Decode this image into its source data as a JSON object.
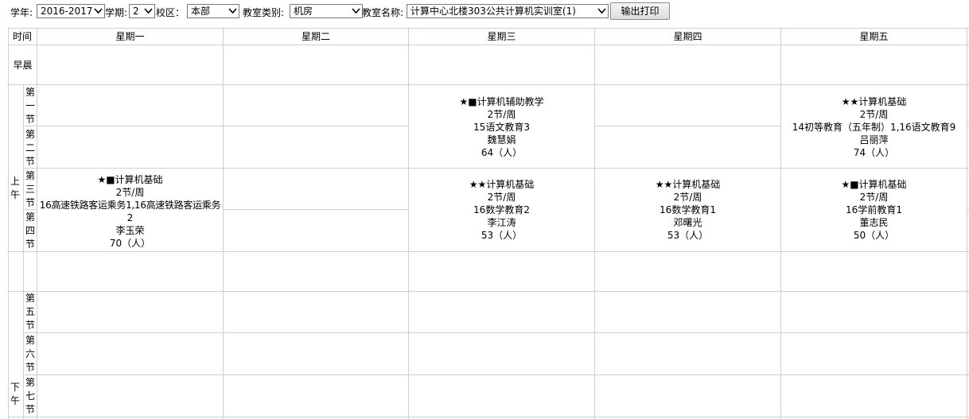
{
  "toolbar": {
    "year_label": "学年:",
    "year_value": "2016-2017",
    "term_label": "学期:",
    "term_value": "2",
    "campus_label": "校区：",
    "campus_value": "本部",
    "room_type_label": "教室类别:",
    "room_type_value": "机房",
    "room_name_label": "教室名称:",
    "room_name_value": "计算中心北楼303公共计算机实训室(1)",
    "print_button": "输出打印"
  },
  "table": {
    "time_header": "时间",
    "days": [
      "星期一",
      "星期二",
      "星期三",
      "星期四",
      "星期五"
    ],
    "early": "早晨",
    "morning": "上午",
    "afternoon": "下午",
    "periods": [
      "第一节",
      "第二节",
      "第三节",
      "第四节",
      "第五节",
      "第六节",
      "第七节"
    ]
  },
  "courses": {
    "wed_12": {
      "title": "★■计算机辅助教学",
      "hours": "2节/周",
      "class": "15语文教育3",
      "teacher": "魏慧娟",
      "count": "64（人）"
    },
    "fri_12": {
      "title": "★★计算机基础",
      "hours": "2节/周",
      "class": "14初等教育（五年制）1,16语文教育9",
      "teacher": "吕丽萍",
      "count": "74（人）"
    },
    "mon_34": {
      "title": "★■计算机基础",
      "hours": "2节/周",
      "class": "16高速铁路客运乘务1,16高速铁路客运乘务",
      "class2": "2",
      "teacher": "李玉荣",
      "count": "70（人）"
    },
    "wed_34": {
      "title": "★★计算机基础",
      "hours": "2节/周",
      "class": "16数学教育2",
      "teacher": "李江涛",
      "count": "53（人）"
    },
    "thu_34": {
      "title": "★★计算机基础",
      "hours": "2节/周",
      "class": "16数学教育1",
      "teacher": "邓曙光",
      "count": "53（人）"
    },
    "fri_34": {
      "title": "★■计算机基础",
      "hours": "2节/周",
      "class": "16学前教育1",
      "teacher": "董志民",
      "count": "50（人）"
    }
  }
}
